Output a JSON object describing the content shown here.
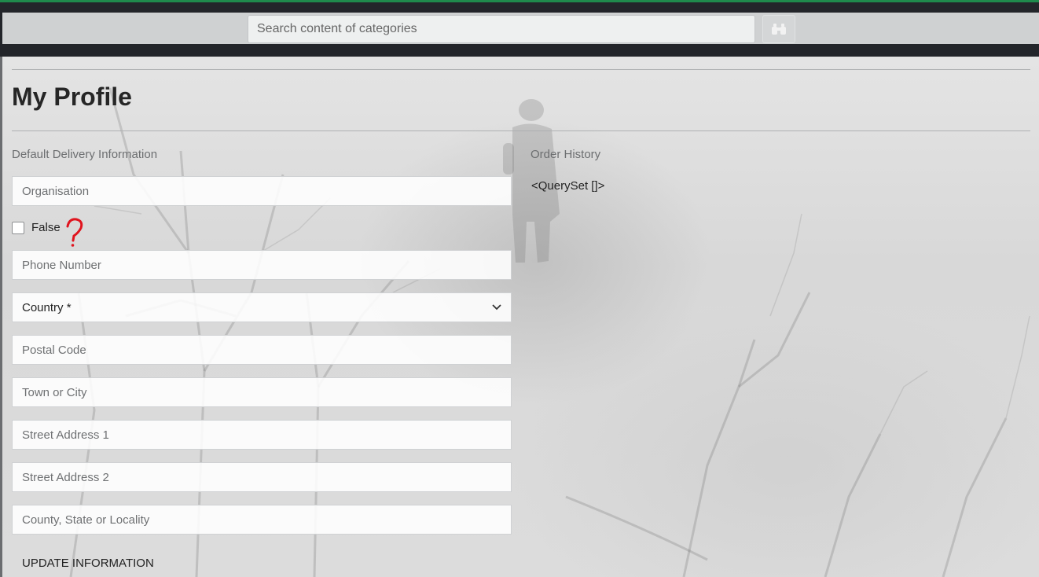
{
  "header": {
    "search_placeholder": "Search content of categories",
    "search_button_icon": "binoculars-icon",
    "accent_color": "#1f8a4c"
  },
  "page": {
    "title": "My Profile"
  },
  "delivery": {
    "section_label": "Default Delivery Information",
    "organisation_placeholder": "Organisation",
    "checkbox_label": "False",
    "checkbox_checked": false,
    "phone_placeholder": "Phone Number",
    "country_selected": "Country *",
    "postal_placeholder": "Postal Code",
    "town_placeholder": "Town or City",
    "street1_placeholder": "Street Address 1",
    "street2_placeholder": "Street Address 2",
    "county_placeholder": "County, State or Locality",
    "update_button": "UPDATE INFORMATION"
  },
  "orders": {
    "section_label": "Order History",
    "queryset_text": "<QuerySet []>"
  },
  "annotation": {
    "mark": "?",
    "color": "#e0141e"
  }
}
